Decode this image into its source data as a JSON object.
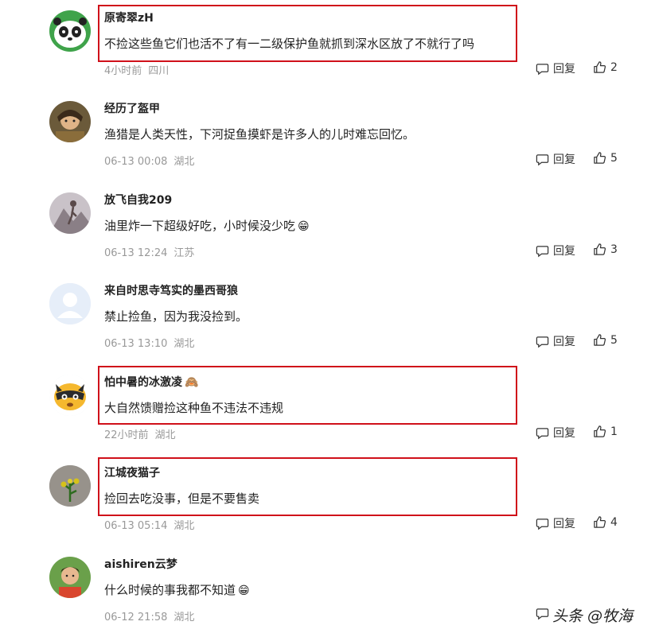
{
  "comments": [
    {
      "username": "原寄翠zH",
      "text": "不捡这些鱼它们也活不了有一二级保护鱼就抓到深水区放了不就行了吗",
      "time": "4小时前",
      "location": "四川",
      "reply_label": "回复",
      "likes": "2",
      "emoji": ""
    },
    {
      "username": "经历了盔甲",
      "text": "渔猎是人类天性，下河捉鱼摸虾是许多人的儿时难忘回忆。",
      "time": "06-13 00:08",
      "location": "湖北",
      "reply_label": "回复",
      "likes": "5",
      "emoji": ""
    },
    {
      "username": "放飞自我209",
      "text": "油里炸一下超级好吃，小时候没少吃",
      "time": "06-13 12:24",
      "location": "江苏",
      "reply_label": "回复",
      "likes": "3",
      "emoji": "😁"
    },
    {
      "username": "来自时思寺笃实的墨西哥狼",
      "text": "禁止捡鱼，因为我没捡到。",
      "time": "06-13 13:10",
      "location": "湖北",
      "reply_label": "回复",
      "likes": "5",
      "emoji": ""
    },
    {
      "username": "怕中暑的冰激凌",
      "text": "大自然馈赠捡这种鱼不违法不违规",
      "time": "22小时前",
      "location": "湖北",
      "reply_label": "回复",
      "likes": "1",
      "emoji": "🙈"
    },
    {
      "username": "江城夜猫子",
      "text": "捡回去吃没事，但是不要售卖",
      "time": "06-13 05:14",
      "location": "湖北",
      "reply_label": "回复",
      "likes": "4",
      "emoji": ""
    },
    {
      "username": "aishiren云梦",
      "text": "什么时候的事我都不知道",
      "time": "06-12 21:58",
      "location": "湖北",
      "reply_label": "",
      "likes": "",
      "emoji": "😁"
    }
  ],
  "watermark": "头条 @牧海",
  "colors": {
    "highlight_border": "#d0101a",
    "meta_text": "#999999"
  }
}
